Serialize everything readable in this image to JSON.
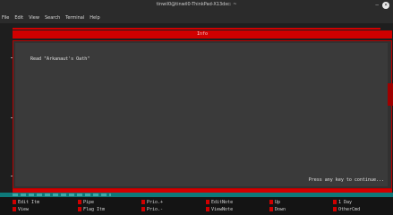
{
  "window": {
    "title": "tinwil0@tinwil0-ThinkPad-X13dxc: ~",
    "minimize_glyph": "–",
    "close_glyph": "×"
  },
  "menu": [
    "File",
    "Edit",
    "View",
    "Search",
    "Terminal",
    "Help"
  ],
  "topbar": {
    "label": "Info"
  },
  "content": {
    "line": "Read \"Arkanaut's Oath\"",
    "prompt": "Press any key to continue..."
  },
  "footer": {
    "row1": [
      "Edit Itm",
      "Pipe",
      "Prio.+",
      "EditNote",
      "Up",
      "1 Day"
    ],
    "row2": [
      "View",
      "Flag Itm",
      "Prio.-",
      "ViewNote",
      "Down",
      "OtherCmd"
    ]
  },
  "colors": {
    "accent_red": "#d00000",
    "teal": "#0d7a7a",
    "panel_bg": "#3a3a3a"
  }
}
